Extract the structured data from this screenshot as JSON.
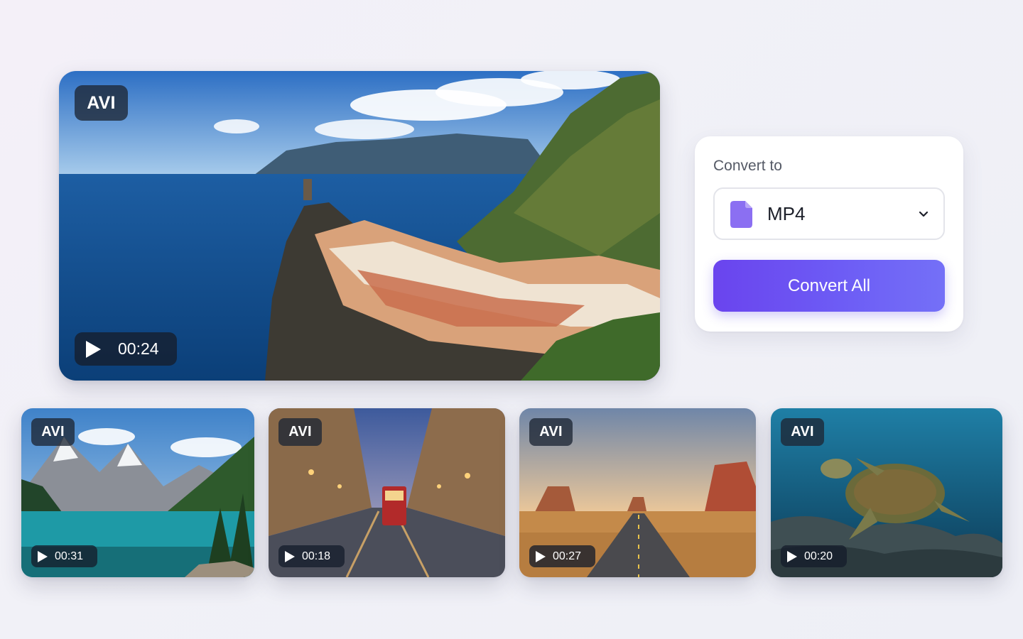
{
  "hero": {
    "format": "AVI",
    "duration": "00:24",
    "scene": "coastal cliff village"
  },
  "thumbnails": [
    {
      "format": "AVI",
      "duration": "00:31",
      "scene": "mountain lake"
    },
    {
      "format": "AVI",
      "duration": "00:18",
      "scene": "city tram street"
    },
    {
      "format": "AVI",
      "duration": "00:27",
      "scene": "desert road"
    },
    {
      "format": "AVI",
      "duration": "00:20",
      "scene": "sea turtle underwater"
    }
  ],
  "convert": {
    "label": "Convert to",
    "selected_format": "MP4",
    "button_label": "Convert All",
    "icon": "file-icon",
    "accent": "#6a4ff0"
  }
}
